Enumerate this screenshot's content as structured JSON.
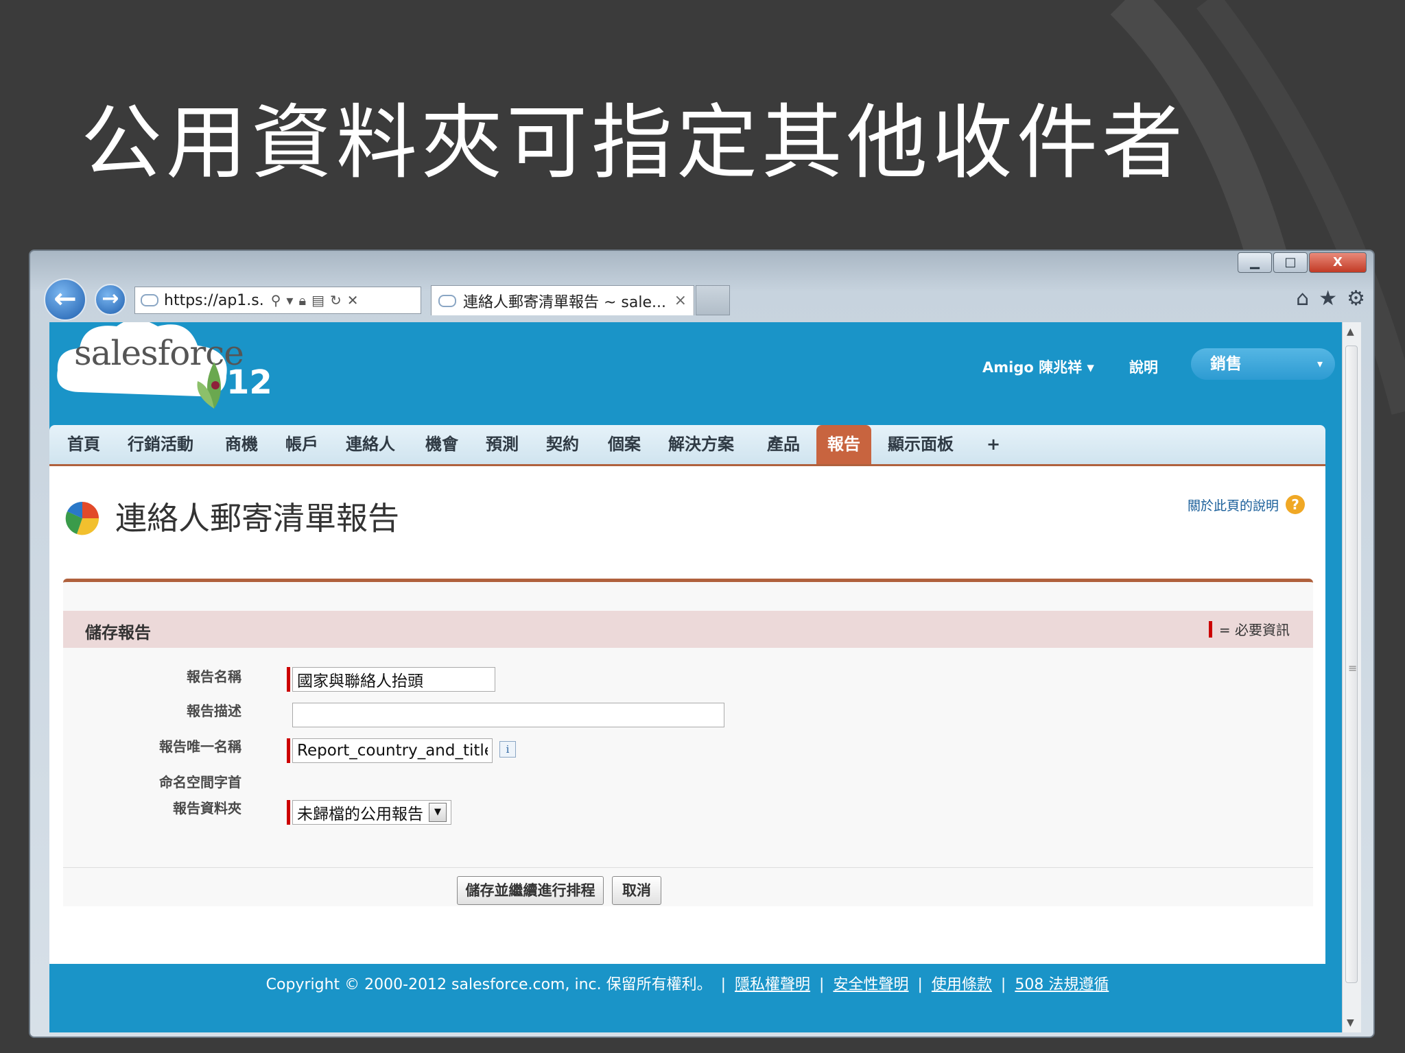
{
  "slide": {
    "title": "公用資料夾可指定其他收件者"
  },
  "browser": {
    "address_url": "https://ap1.s.",
    "tab_title": "連絡人郵寄清單報告 ~ sale...",
    "tab_close": "×",
    "window_buttons": {
      "minimize": "▁",
      "maximize": "□",
      "close": "X"
    }
  },
  "sf": {
    "logo_text": "salesforce",
    "logo_version": "12",
    "user_menu": "Amigo 陳兆祥",
    "user_menu_caret": "▾",
    "help": "說明",
    "app_picker": "銷售",
    "app_picker_caret": "▾",
    "tabs": [
      {
        "label": "首頁"
      },
      {
        "label": "行銷活動"
      },
      {
        "label": "商機"
      },
      {
        "label": "帳戶"
      },
      {
        "label": "連絡人"
      },
      {
        "label": "機會"
      },
      {
        "label": "預測"
      },
      {
        "label": "契約"
      },
      {
        "label": "個案"
      },
      {
        "label": "解決方案"
      },
      {
        "label": "產品"
      },
      {
        "label": "報告",
        "active": true
      },
      {
        "label": "顯示面板"
      },
      {
        "label": "+"
      }
    ]
  },
  "page": {
    "title": "連絡人郵寄清單報告",
    "help_link": "關於此頁的說明",
    "help_icon": "?"
  },
  "form": {
    "section_title": "儲存報告",
    "required_legend": "= 必要資訊",
    "fields": {
      "report_name_label": "報告名稱",
      "report_name_value": "國家與聯絡人抬頭",
      "report_desc_label": "報告描述",
      "report_desc_value": "",
      "unique_name_label": "報告唯一名稱",
      "unique_name_value": "Report_country_and_title",
      "info_icon": "i",
      "namespace_label": "命名空間字首",
      "folder_label": "報告資料夾",
      "folder_value": "未歸檔的公用報告",
      "folder_caret": "▼"
    },
    "buttons": {
      "save_schedule": "儲存並繼續進行排程",
      "cancel": "取消"
    }
  },
  "footer": {
    "copyright": "Copyright © 2000-2012 salesforce.com, inc. 保留所有權利。",
    "links": [
      "隱私權聲明",
      "安全性聲明",
      "使用條款",
      "508 法規遵循"
    ]
  },
  "colors": {
    "slide_bg": "#3b3b3b",
    "sf_blue": "#1a94c8",
    "active_tab": "#c8643f",
    "accent_line": "#b0613d",
    "required_red": "#cc0000"
  }
}
